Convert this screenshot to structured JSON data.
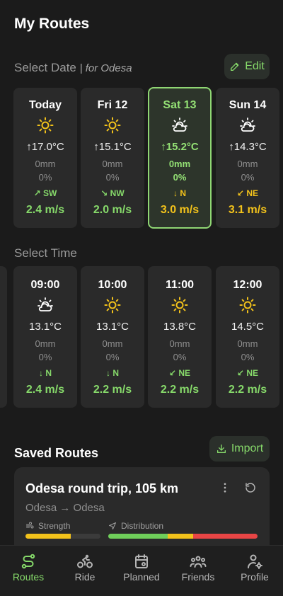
{
  "header": {
    "title": "My Routes"
  },
  "select_date": {
    "label": "Select Date",
    "location": "| for Odesa",
    "edit_label": "Edit",
    "days": [
      {
        "name": "Today",
        "icon": "sun-icon",
        "temp": "↑17.0°C",
        "precip": "0mm",
        "chance": "0%",
        "wind_dir": "↗ SW",
        "wind_speed": "2.4 m/s",
        "speed_color": "green"
      },
      {
        "name": "Fri 12",
        "icon": "sun-icon",
        "temp": "↑15.1°C",
        "precip": "0mm",
        "chance": "0%",
        "wind_dir": "↘ NW",
        "wind_speed": "2.0 m/s",
        "speed_color": "green"
      },
      {
        "name": "Sat 13",
        "icon": "partly-cloudy-icon",
        "temp": "↑15.2°C",
        "precip": "0mm",
        "chance": "0%",
        "wind_dir": "↓ N",
        "wind_speed": "3.0 m/s",
        "speed_color": "yellow",
        "selected": true
      },
      {
        "name": "Sun 14",
        "icon": "partly-cloudy-icon",
        "temp": "↑14.3°C",
        "precip": "0mm",
        "chance": "0%",
        "wind_dir": "↙ NE",
        "wind_speed": "3.1 m/s",
        "speed_color": "yellow"
      }
    ]
  },
  "select_time": {
    "label": "Select Time",
    "hours": [
      {
        "time": "09:00",
        "icon": "partly-cloudy-icon",
        "temp": "13.1°C",
        "precip": "0mm",
        "chance": "0%",
        "wind_dir": "↓ N",
        "wind_speed": "2.4 m/s"
      },
      {
        "time": "10:00",
        "icon": "sun-icon",
        "temp": "13.1°C",
        "precip": "0mm",
        "chance": "0%",
        "wind_dir": "↓ N",
        "wind_speed": "2.2 m/s"
      },
      {
        "time": "11:00",
        "icon": "sun-icon",
        "temp": "13.8°C",
        "precip": "0mm",
        "chance": "0%",
        "wind_dir": "↙ NE",
        "wind_speed": "2.2 m/s"
      },
      {
        "time": "12:00",
        "icon": "sun-icon",
        "temp": "14.5°C",
        "precip": "0mm",
        "chance": "0%",
        "wind_dir": "↙ NE",
        "wind_speed": "2.2 m/s"
      }
    ]
  },
  "saved_routes": {
    "label": "Saved Routes",
    "import_label": "Import",
    "routes": [
      {
        "title": "Odesa round trip, 105 km",
        "subtitle": "Odesa → Odesa",
        "strength_label": "Strength",
        "distribution_label": "Distribution",
        "strength_fraction": 0.6,
        "distribution_segments": [
          {
            "fraction": 0.4,
            "color": "#6fcf5a"
          },
          {
            "fraction": 0.17,
            "color": "#f2c21b"
          },
          {
            "fraction": 0.43,
            "color": "#e84545"
          }
        ]
      }
    ]
  },
  "nav": {
    "items": [
      {
        "label": "Routes",
        "icon": "route-icon",
        "active": true
      },
      {
        "label": "Ride",
        "icon": "bike-icon"
      },
      {
        "label": "Planned",
        "icon": "calendar-icon"
      },
      {
        "label": "Friends",
        "icon": "friends-icon"
      },
      {
        "label": "Profile",
        "icon": "profile-settings-icon"
      }
    ]
  },
  "colors": {
    "accent": "#86d96a",
    "warning": "#f2c21b",
    "danger": "#e84545"
  }
}
